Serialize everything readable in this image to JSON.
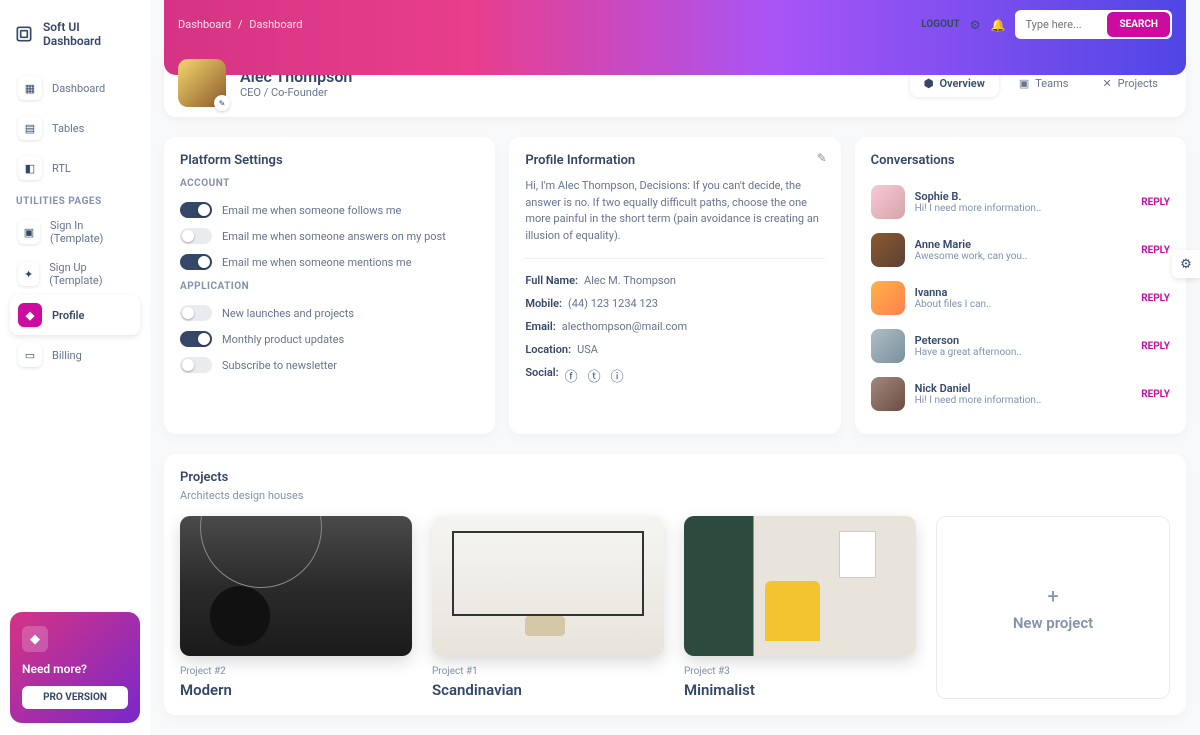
{
  "app": {
    "title": "Soft UI Dashboard"
  },
  "sidebar": {
    "items": [
      "Dashboard",
      "Tables",
      "RTL"
    ],
    "section_label": "UTILITIES PAGES",
    "util_items": [
      "Sign In (Template)",
      "Sign Up (Template)",
      "Profile",
      "Billing"
    ]
  },
  "help": {
    "title": "Need more?",
    "button": "PRO VERSION"
  },
  "breadcrumb": {
    "root": "Dashboard",
    "current": "Dashboard"
  },
  "topbar": {
    "logout": "LOGOUT",
    "search_placeholder": "Type here...",
    "search_btn": "SEARCH"
  },
  "profile": {
    "name": "Alec Thompson",
    "role": "CEO / Co-Founder",
    "tabs": [
      "Overview",
      "Teams",
      "Projects"
    ]
  },
  "settings": {
    "title": "Platform Settings",
    "account_label": "ACCOUNT",
    "account": [
      {
        "label": "Email me when someone follows me",
        "on": true
      },
      {
        "label": "Email me when someone answers on my post",
        "on": false
      },
      {
        "label": "Email me when someone mentions me",
        "on": true
      }
    ],
    "app_label": "APPLICATION",
    "app": [
      {
        "label": "New launches and projects",
        "on": false
      },
      {
        "label": "Monthly product updates",
        "on": true
      },
      {
        "label": "Subscribe to newsletter",
        "on": false
      }
    ]
  },
  "info": {
    "title": "Profile Information",
    "bio": "Hi, I'm Alec Thompson, Decisions: If you can't decide, the answer is no. If two equally difficult paths, choose the one more painful in the short term (pain avoidance is creating an illusion of equality).",
    "fields": {
      "fullname_k": "Full Name:",
      "fullname_v": "Alec M. Thompson",
      "mobile_k": "Mobile:",
      "mobile_v": "(44) 123 1234 123",
      "email_k": "Email:",
      "email_v": "alecthompson@mail.com",
      "location_k": "Location:",
      "location_v": "USA",
      "social_k": "Social:"
    }
  },
  "convo": {
    "title": "Conversations",
    "reply_label": "REPLY",
    "items": [
      {
        "name": "Sophie B.",
        "msg": "Hi! I need more information.."
      },
      {
        "name": "Anne Marie",
        "msg": "Awesome work, can you.."
      },
      {
        "name": "Ivanna",
        "msg": "About files I can.."
      },
      {
        "name": "Peterson",
        "msg": "Have a great afternoon.."
      },
      {
        "name": "Nick Daniel",
        "msg": "Hi! I need more information.."
      }
    ]
  },
  "projects": {
    "title": "Projects",
    "subtitle": "Architects design houses",
    "items": [
      {
        "tag": "Project #2",
        "title": "Modern"
      },
      {
        "tag": "Project #1",
        "title": "Scandinavian"
      },
      {
        "tag": "Project #3",
        "title": "Minimalist"
      }
    ],
    "new_label": "New project"
  }
}
